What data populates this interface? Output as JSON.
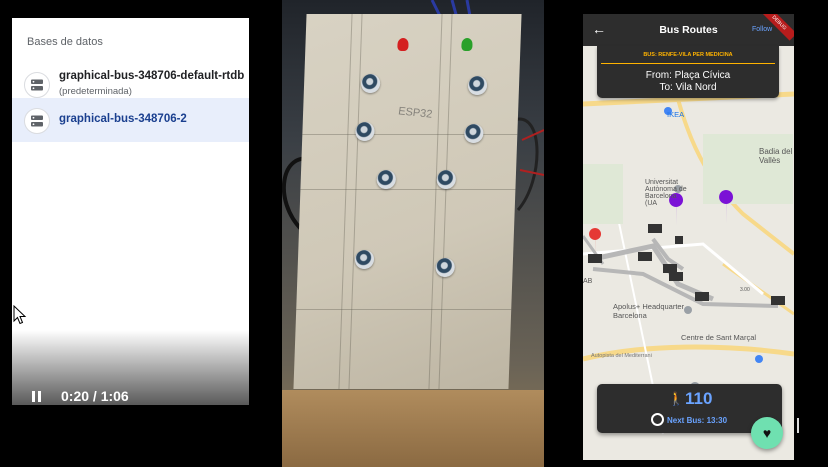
{
  "left": {
    "section_title": "Bases de datos",
    "databases": [
      {
        "name": "graphical-bus-348706-default-rtdb",
        "subtitle": "(predeterminada)",
        "icon": "database-icon",
        "selected": false
      },
      {
        "name": "graphical-bus-348706-2",
        "subtitle": "",
        "icon": "database-icon",
        "selected": true
      }
    ],
    "player": {
      "state_icon": "pause-icon",
      "time": "0:20 / 1:06"
    }
  },
  "photo": {
    "board_text": "ESP32",
    "led_colors": [
      "#d42020",
      "#2aa02a"
    ]
  },
  "phone": {
    "title": "Bus Routes",
    "follow_label": "Follow",
    "debug_banner": "DEBUG",
    "route": {
      "name": "BUS: RENFE-VILA PER MEDICINA",
      "from": "From: Plaça Cívica",
      "to": "To: Vila Nord"
    },
    "map_labels": {
      "ikea": "IKEA",
      "badia": "Badia del\nVallès",
      "university": "Universitat\nAutònoma de\nBarcelona\n(UA",
      "apolus": "Apolus+ Headquarter\nBarcelona",
      "centre": "Centre de Sant Marçal",
      "road": "Autopista del Mediterrani",
      "ab": "AB",
      "km": "3.00"
    },
    "info": {
      "people_count": "110",
      "next_bus": "Next Bus: 13:30"
    },
    "colors": {
      "accent": "#6aa3ff",
      "warning": "#ffb300",
      "fab": "#6fe0b0"
    }
  }
}
